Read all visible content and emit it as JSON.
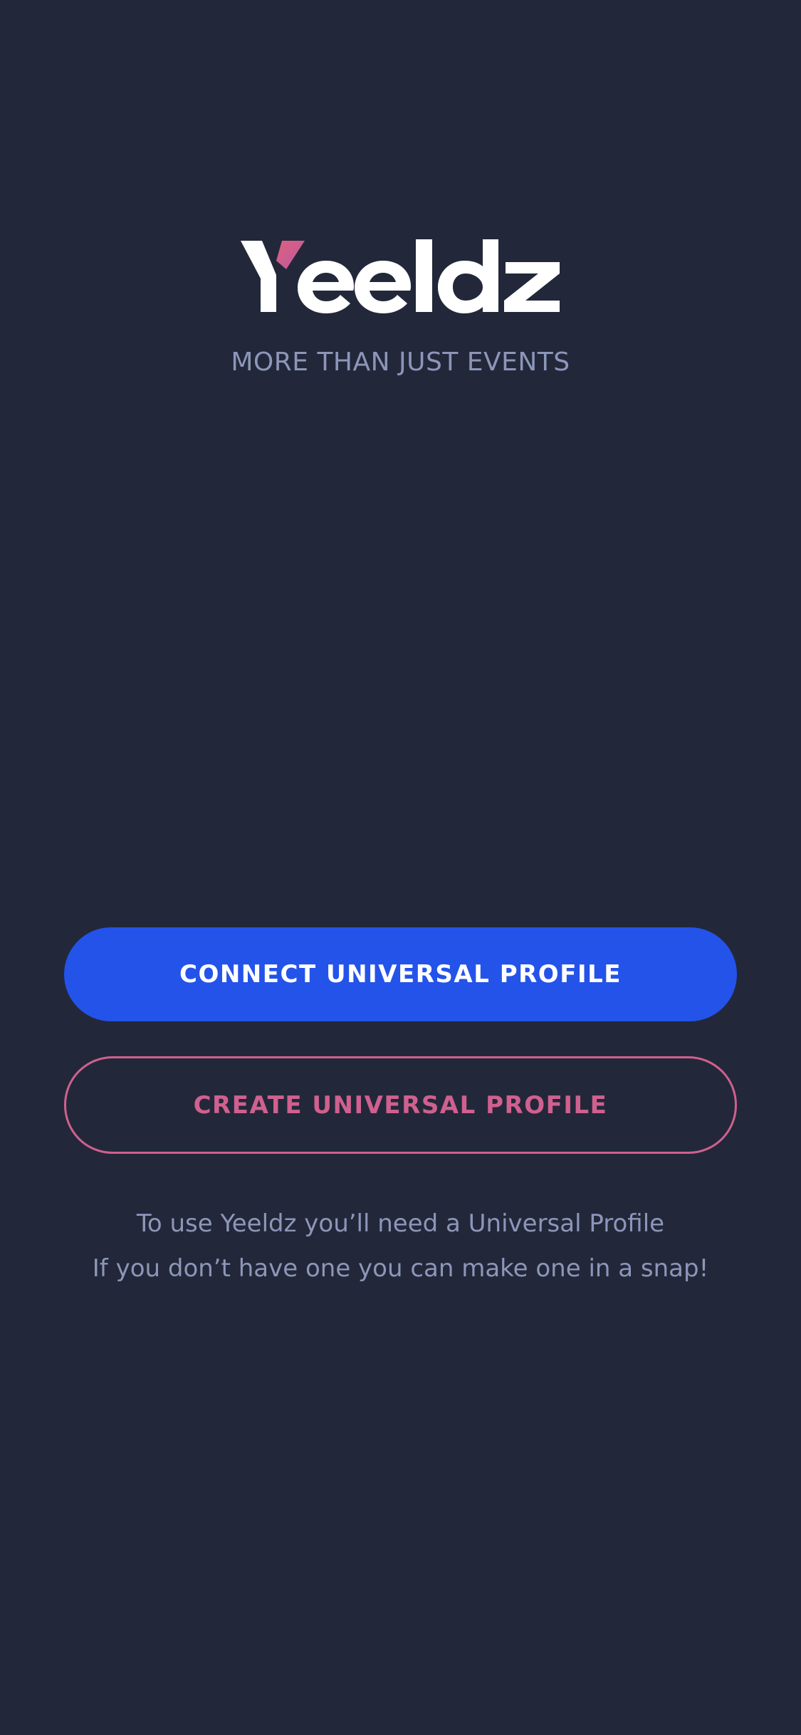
{
  "brand": {
    "name": "Yeeldz",
    "tagline": "MORE THAN JUST EVENTS",
    "accent_color": "#D0608F",
    "primary_color": "#2453EA",
    "background_color": "#222839"
  },
  "actions": {
    "connect_label": "CONNECT UNIVERSAL PROFILE",
    "create_label": "CREATE UNIVERSAL PROFILE"
  },
  "info": {
    "line1": "To use Yeeldz you’ll need a Universal Profile",
    "line2": "If you don’t have one you can make one in a snap!"
  }
}
